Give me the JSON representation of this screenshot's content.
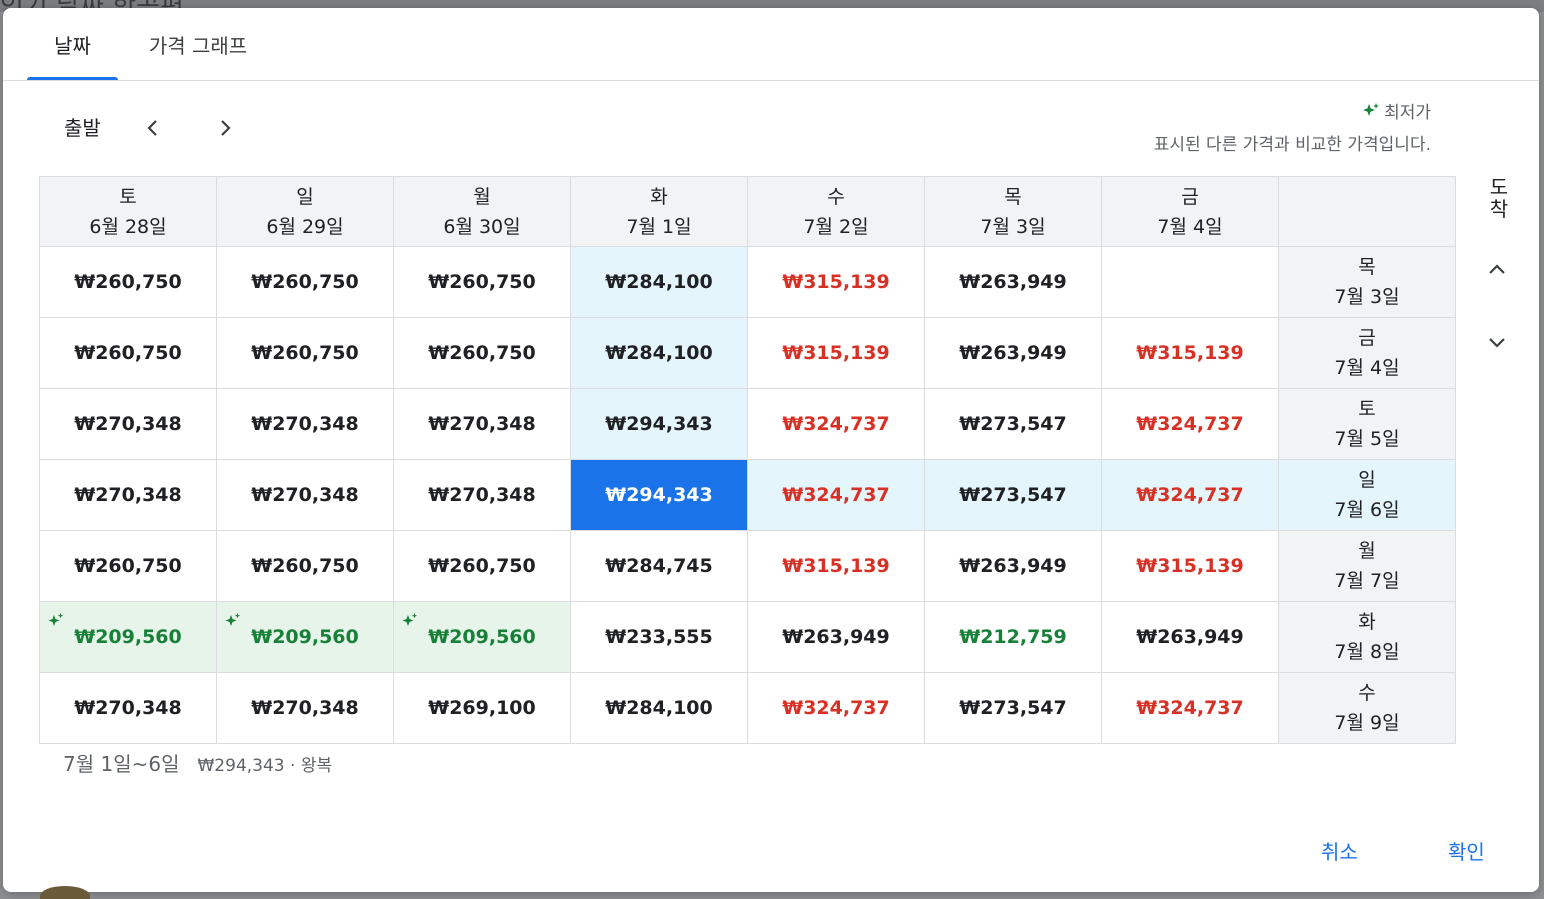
{
  "backdrop": {
    "text": "인기 날짜 항공편"
  },
  "tabs": [
    {
      "label": "날짜",
      "active": true
    },
    {
      "label": "가격 그래프",
      "active": false
    }
  ],
  "departure": {
    "label": "출발"
  },
  "legend": {
    "label": "최저가",
    "description": "표시된 다른 가격과 비교한 가격입니다."
  },
  "arrival": {
    "label": "도착"
  },
  "columns": [
    {
      "weekday": "토",
      "date": "6월 28일"
    },
    {
      "weekday": "일",
      "date": "6월 29일"
    },
    {
      "weekday": "월",
      "date": "6월 30일"
    },
    {
      "weekday": "화",
      "date": "7월 1일"
    },
    {
      "weekday": "수",
      "date": "7월 2일"
    },
    {
      "weekday": "목",
      "date": "7월 3일"
    },
    {
      "weekday": "금",
      "date": "7월 4일"
    }
  ],
  "rows": [
    {
      "weekday": "목",
      "date": "7월 3일",
      "prices": [
        {
          "v": "₩260,750",
          "t": ""
        },
        {
          "v": "₩260,750",
          "t": ""
        },
        {
          "v": "₩260,750",
          "t": ""
        },
        {
          "v": "₩284,100",
          "t": ""
        },
        {
          "v": "₩315,139",
          "t": "high"
        },
        {
          "v": "₩263,949",
          "t": ""
        },
        {
          "v": "",
          "t": ""
        }
      ]
    },
    {
      "weekday": "금",
      "date": "7월 4일",
      "prices": [
        {
          "v": "₩260,750",
          "t": ""
        },
        {
          "v": "₩260,750",
          "t": ""
        },
        {
          "v": "₩260,750",
          "t": ""
        },
        {
          "v": "₩284,100",
          "t": ""
        },
        {
          "v": "₩315,139",
          "t": "high"
        },
        {
          "v": "₩263,949",
          "t": ""
        },
        {
          "v": "₩315,139",
          "t": "high"
        }
      ]
    },
    {
      "weekday": "토",
      "date": "7월 5일",
      "prices": [
        {
          "v": "₩270,348",
          "t": ""
        },
        {
          "v": "₩270,348",
          "t": ""
        },
        {
          "v": "₩270,348",
          "t": ""
        },
        {
          "v": "₩294,343",
          "t": ""
        },
        {
          "v": "₩324,737",
          "t": "high"
        },
        {
          "v": "₩273,547",
          "t": ""
        },
        {
          "v": "₩324,737",
          "t": "high"
        }
      ]
    },
    {
      "weekday": "일",
      "date": "7월 6일",
      "prices": [
        {
          "v": "₩270,348",
          "t": ""
        },
        {
          "v": "₩270,348",
          "t": ""
        },
        {
          "v": "₩270,348",
          "t": ""
        },
        {
          "v": "₩294,343",
          "t": "selected"
        },
        {
          "v": "₩324,737",
          "t": "high"
        },
        {
          "v": "₩273,547",
          "t": ""
        },
        {
          "v": "₩324,737",
          "t": "high"
        }
      ]
    },
    {
      "weekday": "월",
      "date": "7월 7일",
      "prices": [
        {
          "v": "₩260,750",
          "t": ""
        },
        {
          "v": "₩260,750",
          "t": ""
        },
        {
          "v": "₩260,750",
          "t": ""
        },
        {
          "v": "₩284,745",
          "t": ""
        },
        {
          "v": "₩315,139",
          "t": "high"
        },
        {
          "v": "₩263,949",
          "t": ""
        },
        {
          "v": "₩315,139",
          "t": "high"
        }
      ]
    },
    {
      "weekday": "화",
      "date": "7월 8일",
      "prices": [
        {
          "v": "₩209,560",
          "t": "lowest"
        },
        {
          "v": "₩209,560",
          "t": "lowest"
        },
        {
          "v": "₩209,560",
          "t": "lowest"
        },
        {
          "v": "₩233,555",
          "t": ""
        },
        {
          "v": "₩263,949",
          "t": ""
        },
        {
          "v": "₩212,759",
          "t": "low"
        },
        {
          "v": "₩263,949",
          "t": ""
        }
      ]
    },
    {
      "weekday": "수",
      "date": "7월 9일",
      "prices": [
        {
          "v": "₩270,348",
          "t": ""
        },
        {
          "v": "₩270,348",
          "t": ""
        },
        {
          "v": "₩269,100",
          "t": ""
        },
        {
          "v": "₩284,100",
          "t": ""
        },
        {
          "v": "₩324,737",
          "t": "high"
        },
        {
          "v": "₩273,547",
          "t": ""
        },
        {
          "v": "₩324,737",
          "t": "high"
        }
      ]
    }
  ],
  "selection": {
    "column": 3,
    "row": 3
  },
  "summary": {
    "dates": "7월 1일~6일",
    "info": "₩294,343 · 왕복"
  },
  "actions": {
    "cancel": "취소",
    "confirm": "확인"
  },
  "colors": {
    "accent": "#1a73e8",
    "high": "#d93025",
    "low": "#188038",
    "highlight": "#e4f6fb",
    "lowCell": "#e6f4ea"
  }
}
